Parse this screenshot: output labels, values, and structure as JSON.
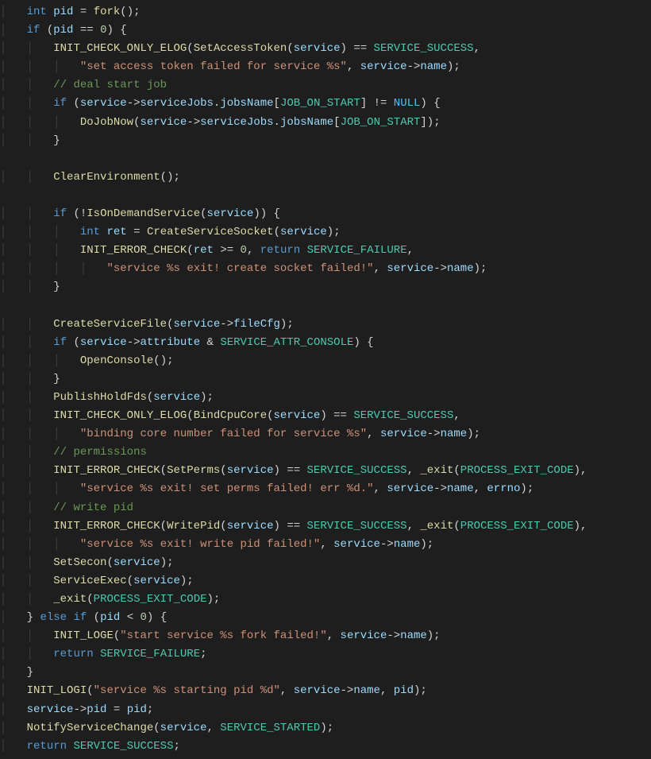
{
  "code": {
    "lines": [
      [
        [
          "sp",
          "    "
        ],
        [
          "kw",
          "int"
        ],
        [
          "op",
          " "
        ],
        [
          "var",
          "pid"
        ],
        [
          "op",
          " = "
        ],
        [
          "fn",
          "fork"
        ],
        [
          "op",
          "();"
        ]
      ],
      [
        [
          "sp",
          "    "
        ],
        [
          "kw",
          "if"
        ],
        [
          "op",
          " ("
        ],
        [
          "var",
          "pid"
        ],
        [
          "op",
          " == "
        ],
        [
          "num",
          "0"
        ],
        [
          "op",
          ") {"
        ]
      ],
      [
        [
          "sp",
          "        "
        ],
        [
          "fn",
          "INIT_CHECK_ONLY_ELOG"
        ],
        [
          "op",
          "("
        ],
        [
          "fn",
          "SetAccessToken"
        ],
        [
          "op",
          "("
        ],
        [
          "var",
          "service"
        ],
        [
          "op",
          ") == "
        ],
        [
          "mac",
          "SERVICE_SUCCESS"
        ],
        [
          "op",
          ","
        ]
      ],
      [
        [
          "sp",
          "            "
        ],
        [
          "str",
          "\"set access token failed for service %s\""
        ],
        [
          "op",
          ", "
        ],
        [
          "var",
          "service"
        ],
        [
          "op",
          "->"
        ],
        [
          "var",
          "name"
        ],
        [
          "op",
          ");"
        ]
      ],
      [
        [
          "sp",
          "        "
        ],
        [
          "cmt",
          "// deal start job"
        ]
      ],
      [
        [
          "sp",
          "        "
        ],
        [
          "kw",
          "if"
        ],
        [
          "op",
          " ("
        ],
        [
          "var",
          "service"
        ],
        [
          "op",
          "->"
        ],
        [
          "var",
          "serviceJobs"
        ],
        [
          "op",
          "."
        ],
        [
          "var",
          "jobsName"
        ],
        [
          "op",
          "["
        ],
        [
          "mac",
          "JOB_ON_START"
        ],
        [
          "op",
          "] != "
        ],
        [
          "cnst",
          "NULL"
        ],
        [
          "op",
          ") {"
        ]
      ],
      [
        [
          "sp",
          "            "
        ],
        [
          "fn",
          "DoJobNow"
        ],
        [
          "op",
          "("
        ],
        [
          "var",
          "service"
        ],
        [
          "op",
          "->"
        ],
        [
          "var",
          "serviceJobs"
        ],
        [
          "op",
          "."
        ],
        [
          "var",
          "jobsName"
        ],
        [
          "op",
          "["
        ],
        [
          "mac",
          "JOB_ON_START"
        ],
        [
          "op",
          "]);"
        ]
      ],
      [
        [
          "sp",
          "        "
        ],
        [
          "op",
          "}"
        ]
      ],
      [
        [
          "sp",
          ""
        ]
      ],
      [
        [
          "sp",
          "        "
        ],
        [
          "fn",
          "ClearEnvironment"
        ],
        [
          "op",
          "();"
        ]
      ],
      [
        [
          "sp",
          ""
        ]
      ],
      [
        [
          "sp",
          "        "
        ],
        [
          "kw",
          "if"
        ],
        [
          "op",
          " (!"
        ],
        [
          "fn",
          "IsOnDemandService"
        ],
        [
          "op",
          "("
        ],
        [
          "var",
          "service"
        ],
        [
          "op",
          ")) {"
        ]
      ],
      [
        [
          "sp",
          "            "
        ],
        [
          "kw",
          "int"
        ],
        [
          "op",
          " "
        ],
        [
          "var",
          "ret"
        ],
        [
          "op",
          " = "
        ],
        [
          "fn",
          "CreateServiceSocket"
        ],
        [
          "op",
          "("
        ],
        [
          "var",
          "service"
        ],
        [
          "op",
          ");"
        ]
      ],
      [
        [
          "sp",
          "            "
        ],
        [
          "fn",
          "INIT_ERROR_CHECK"
        ],
        [
          "op",
          "("
        ],
        [
          "var",
          "ret"
        ],
        [
          "op",
          " >= "
        ],
        [
          "num",
          "0"
        ],
        [
          "op",
          ", "
        ],
        [
          "kw",
          "return"
        ],
        [
          "op",
          " "
        ],
        [
          "mac",
          "SERVICE_FAILURE"
        ],
        [
          "op",
          ","
        ]
      ],
      [
        [
          "sp",
          "                "
        ],
        [
          "str",
          "\"service %s exit! create socket failed!\""
        ],
        [
          "op",
          ", "
        ],
        [
          "var",
          "service"
        ],
        [
          "op",
          "->"
        ],
        [
          "var",
          "name"
        ],
        [
          "op",
          ");"
        ]
      ],
      [
        [
          "sp",
          "        "
        ],
        [
          "op",
          "}"
        ]
      ],
      [
        [
          "sp",
          ""
        ]
      ],
      [
        [
          "sp",
          "        "
        ],
        [
          "fn",
          "CreateServiceFile"
        ],
        [
          "op",
          "("
        ],
        [
          "var",
          "service"
        ],
        [
          "op",
          "->"
        ],
        [
          "var",
          "fileCfg"
        ],
        [
          "op",
          ");"
        ]
      ],
      [
        [
          "sp",
          "        "
        ],
        [
          "kw",
          "if"
        ],
        [
          "op",
          " ("
        ],
        [
          "var",
          "service"
        ],
        [
          "op",
          "->"
        ],
        [
          "var",
          "attribute"
        ],
        [
          "op",
          " & "
        ],
        [
          "mac",
          "SERVICE_ATTR_CONSOLE"
        ],
        [
          "op",
          ") {"
        ]
      ],
      [
        [
          "sp",
          "            "
        ],
        [
          "fn",
          "OpenConsole"
        ],
        [
          "op",
          "();"
        ]
      ],
      [
        [
          "sp",
          "        "
        ],
        [
          "op",
          "}"
        ]
      ],
      [
        [
          "sp",
          "        "
        ],
        [
          "fn",
          "PublishHoldFds"
        ],
        [
          "op",
          "("
        ],
        [
          "var",
          "service"
        ],
        [
          "op",
          ");"
        ]
      ],
      [
        [
          "sp",
          "        "
        ],
        [
          "fn",
          "INIT_CHECK_ONLY_ELOG"
        ],
        [
          "op",
          "("
        ],
        [
          "fn",
          "BindCpuCore"
        ],
        [
          "op",
          "("
        ],
        [
          "var",
          "service"
        ],
        [
          "op",
          ") == "
        ],
        [
          "mac",
          "SERVICE_SUCCESS"
        ],
        [
          "op",
          ","
        ]
      ],
      [
        [
          "sp",
          "            "
        ],
        [
          "str",
          "\"binding core number failed for service %s\""
        ],
        [
          "op",
          ", "
        ],
        [
          "var",
          "service"
        ],
        [
          "op",
          "->"
        ],
        [
          "var",
          "name"
        ],
        [
          "op",
          ");"
        ]
      ],
      [
        [
          "sp",
          "        "
        ],
        [
          "cmt",
          "// permissions"
        ]
      ],
      [
        [
          "sp",
          "        "
        ],
        [
          "fn",
          "INIT_ERROR_CHECK"
        ],
        [
          "op",
          "("
        ],
        [
          "fn",
          "SetPerms"
        ],
        [
          "op",
          "("
        ],
        [
          "var",
          "service"
        ],
        [
          "op",
          ") == "
        ],
        [
          "mac",
          "SERVICE_SUCCESS"
        ],
        [
          "op",
          ", "
        ],
        [
          "fn",
          "_exit"
        ],
        [
          "op",
          "("
        ],
        [
          "mac",
          "PROCESS_EXIT_CODE"
        ],
        [
          "op",
          "),"
        ]
      ],
      [
        [
          "sp",
          "            "
        ],
        [
          "str",
          "\"service %s exit! set perms failed! err %d.\""
        ],
        [
          "op",
          ", "
        ],
        [
          "var",
          "service"
        ],
        [
          "op",
          "->"
        ],
        [
          "var",
          "name"
        ],
        [
          "op",
          ", "
        ],
        [
          "var",
          "errno"
        ],
        [
          "op",
          ");"
        ]
      ],
      [
        [
          "sp",
          "        "
        ],
        [
          "cmt",
          "// write pid"
        ]
      ],
      [
        [
          "sp",
          "        "
        ],
        [
          "fn",
          "INIT_ERROR_CHECK"
        ],
        [
          "op",
          "("
        ],
        [
          "fn",
          "WritePid"
        ],
        [
          "op",
          "("
        ],
        [
          "var",
          "service"
        ],
        [
          "op",
          ") == "
        ],
        [
          "mac",
          "SERVICE_SUCCESS"
        ],
        [
          "op",
          ", "
        ],
        [
          "fn",
          "_exit"
        ],
        [
          "op",
          "("
        ],
        [
          "mac",
          "PROCESS_EXIT_CODE"
        ],
        [
          "op",
          "),"
        ]
      ],
      [
        [
          "sp",
          "            "
        ],
        [
          "str",
          "\"service %s exit! write pid failed!\""
        ],
        [
          "op",
          ", "
        ],
        [
          "var",
          "service"
        ],
        [
          "op",
          "->"
        ],
        [
          "var",
          "name"
        ],
        [
          "op",
          ");"
        ]
      ],
      [
        [
          "sp",
          "        "
        ],
        [
          "fn",
          "SetSecon"
        ],
        [
          "op",
          "("
        ],
        [
          "var",
          "service"
        ],
        [
          "op",
          ");"
        ]
      ],
      [
        [
          "sp",
          "        "
        ],
        [
          "fn",
          "ServiceExec"
        ],
        [
          "op",
          "("
        ],
        [
          "var",
          "service"
        ],
        [
          "op",
          ");"
        ]
      ],
      [
        [
          "sp",
          "        "
        ],
        [
          "fn",
          "_exit"
        ],
        [
          "op",
          "("
        ],
        [
          "mac",
          "PROCESS_EXIT_CODE"
        ],
        [
          "op",
          ");"
        ]
      ],
      [
        [
          "sp",
          "    "
        ],
        [
          "op",
          "} "
        ],
        [
          "kw",
          "else"
        ],
        [
          "op",
          " "
        ],
        [
          "kw",
          "if"
        ],
        [
          "op",
          " ("
        ],
        [
          "var",
          "pid"
        ],
        [
          "op",
          " < "
        ],
        [
          "num",
          "0"
        ],
        [
          "op",
          ") {"
        ]
      ],
      [
        [
          "sp",
          "        "
        ],
        [
          "fn",
          "INIT_LOGE"
        ],
        [
          "op",
          "("
        ],
        [
          "str",
          "\"start service %s fork failed!\""
        ],
        [
          "op",
          ", "
        ],
        [
          "var",
          "service"
        ],
        [
          "op",
          "->"
        ],
        [
          "var",
          "name"
        ],
        [
          "op",
          ");"
        ]
      ],
      [
        [
          "sp",
          "        "
        ],
        [
          "kw",
          "return"
        ],
        [
          "op",
          " "
        ],
        [
          "mac",
          "SERVICE_FAILURE"
        ],
        [
          "op",
          ";"
        ]
      ],
      [
        [
          "sp",
          "    "
        ],
        [
          "op",
          "}"
        ]
      ],
      [
        [
          "sp",
          "    "
        ],
        [
          "fn",
          "INIT_LOGI"
        ],
        [
          "op",
          "("
        ],
        [
          "str",
          "\"service %s starting pid %d\""
        ],
        [
          "op",
          ", "
        ],
        [
          "var",
          "service"
        ],
        [
          "op",
          "->"
        ],
        [
          "var",
          "name"
        ],
        [
          "op",
          ", "
        ],
        [
          "var",
          "pid"
        ],
        [
          "op",
          ");"
        ]
      ],
      [
        [
          "sp",
          "    "
        ],
        [
          "var",
          "service"
        ],
        [
          "op",
          "->"
        ],
        [
          "var",
          "pid"
        ],
        [
          "op",
          " = "
        ],
        [
          "var",
          "pid"
        ],
        [
          "op",
          ";"
        ]
      ],
      [
        [
          "sp",
          "    "
        ],
        [
          "fn",
          "NotifyServiceChange"
        ],
        [
          "op",
          "("
        ],
        [
          "var",
          "service"
        ],
        [
          "op",
          ", "
        ],
        [
          "mac",
          "SERVICE_STARTED"
        ],
        [
          "op",
          ");"
        ]
      ],
      [
        [
          "sp",
          "    "
        ],
        [
          "kw",
          "return"
        ],
        [
          "op",
          " "
        ],
        [
          "mac",
          "SERVICE_SUCCESS"
        ],
        [
          "op",
          ";"
        ]
      ]
    ]
  }
}
